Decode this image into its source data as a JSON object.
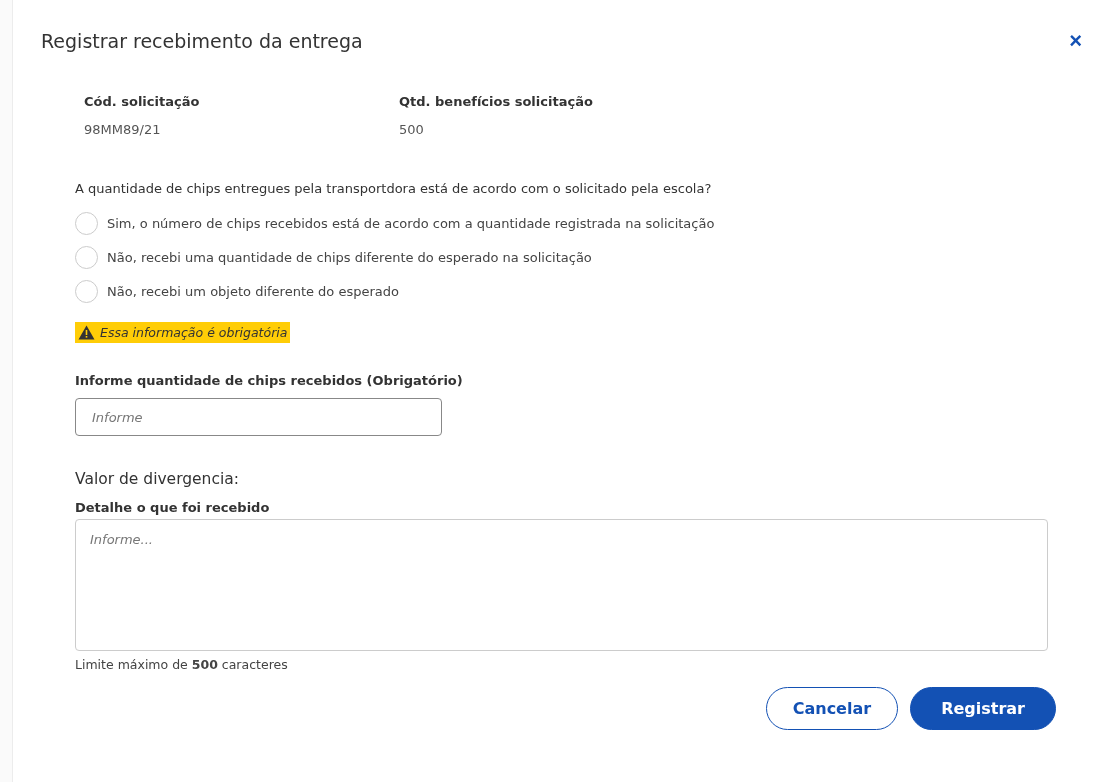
{
  "dialog": {
    "title": "Registrar recebimento da entrega",
    "close": "×"
  },
  "info": [
    {
      "label": "Cód. solicitação",
      "value": "98MM89/21"
    },
    {
      "label": "Qtd. benefícios solicitação",
      "value": "500"
    }
  ],
  "question": {
    "text": "A quantidade de chips entregues pela transportdora está de acordo com o solicitado pela escola?",
    "options": [
      {
        "label": "Sim, o número de chips recebidos está de acordo com a quantidade registrada na solicitação",
        "selected": false
      },
      {
        "label": "Não, recebi uma quantidade de chips diferente do esperado na solicitação",
        "selected": false
      },
      {
        "label": "Não, recebi um objeto diferente do esperado",
        "selected": false
      }
    ],
    "warning": "Essa informação é obrigatória"
  },
  "quantity_field": {
    "label": "Informe quantidade de chips recebidos (Obrigatório)",
    "placeholder": "Informe"
  },
  "divergence": {
    "heading": "Valor de divergencia:",
    "label": "Detalhe o que foi recebido",
    "placeholder": "Informe...",
    "limit": "Limite máximo de **500** caracteres"
  },
  "buttons": [
    {
      "label": "Cancelar",
      "kind": "secondary"
    },
    {
      "label": "Registrar",
      "kind": "primary"
    }
  ]
}
